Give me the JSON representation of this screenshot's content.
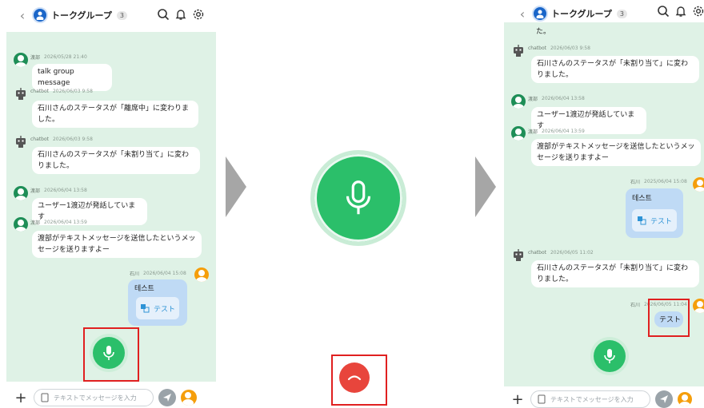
{
  "header": {
    "title": "トークグループ",
    "count": "3",
    "back_icon": "chevron-left-icon"
  },
  "input": {
    "placeholder": "テキストでメッセージを入力"
  },
  "panel1": {
    "messages": [
      {
        "sender": "渡部",
        "time": "2026/05/28 21:40",
        "text": "talk group message"
      },
      {
        "sender": "chatbot",
        "time": "2026/06/03 9:58",
        "text": "石川さんのステータスが「離席中」に変わりました。"
      },
      {
        "sender": "chatbot",
        "time": "2026/06/03 9:58",
        "text": "石川さんのステータスが「未割り当て」に変わりました。"
      },
      {
        "sender": "渡部",
        "time": "2026/06/04 13:58",
        "text": "ユーザー1渡辺が発話しています"
      },
      {
        "sender": "渡部",
        "time": "2026/06/04 13:59",
        "text": "渡部がテキストメッセージを送信したというメッセージを送りますよー"
      },
      {
        "sender": "石川",
        "time": "2026/06/04 15:08",
        "title": "테스트",
        "translation": "テスト"
      }
    ]
  },
  "panel3": {
    "top_fragment": "た。",
    "messages": [
      {
        "sender": "chatbot",
        "time": "2026/06/03 9:58",
        "text": "石川さんのステータスが「未割り当て」に変わりました。"
      },
      {
        "sender": "渡部",
        "time": "2026/06/04 13:58",
        "text": "ユーザー1渡辺が発話しています"
      },
      {
        "sender": "渡部",
        "time": "2026/06/04 13:59",
        "text": "渡部がテキストメッセージを送信したというメッセージを送りますよー"
      },
      {
        "sender": "石川",
        "time": "2025/06/04 15:08",
        "title": "테스트",
        "translation": "テスト"
      },
      {
        "sender": "chatbot",
        "time": "2026/06/05 11:02",
        "text": "石川さんのステータスが「未割り当て」に変わりました。"
      },
      {
        "sender": "石川",
        "time": "2026/06/05 11:04",
        "text": "テスト"
      }
    ]
  },
  "colors": {
    "accent": "#2bbf6a",
    "chat_bg": "#dff2e6",
    "highlight": "#e02020",
    "end_call": "#e8453c"
  }
}
